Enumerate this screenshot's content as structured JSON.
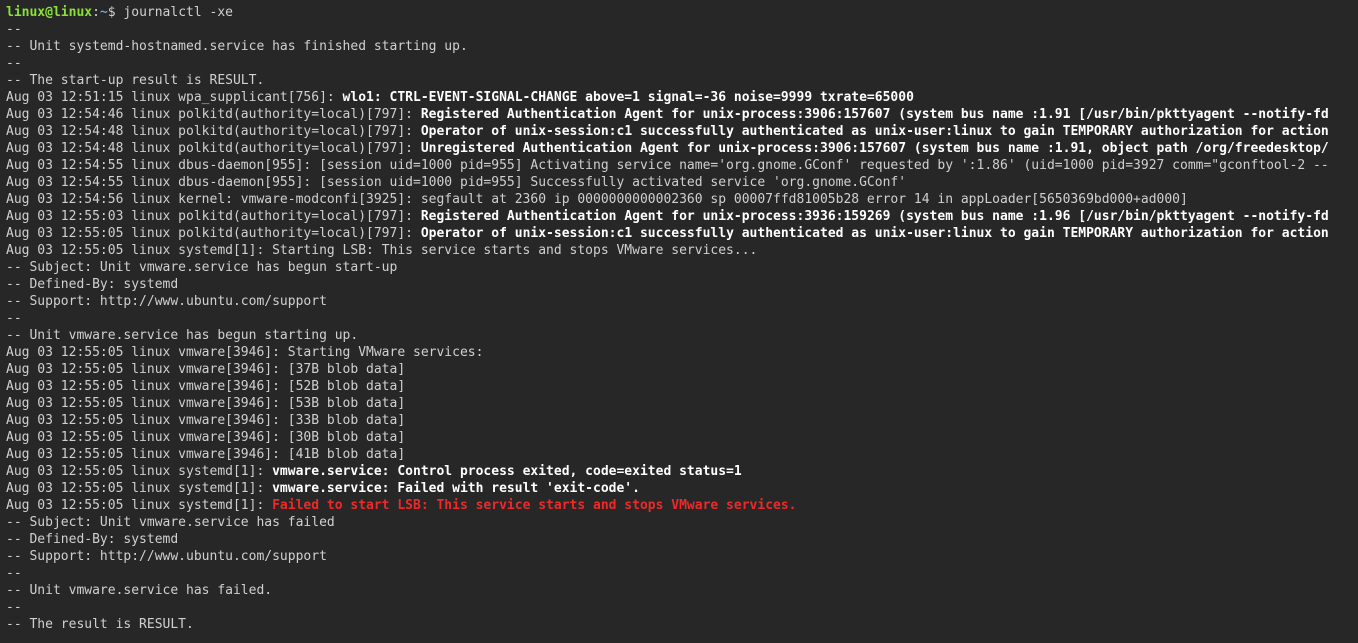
{
  "prompt": {
    "user": "linux",
    "host": "linux",
    "path": "~",
    "command": "journalctl -xe"
  },
  "lines": [
    {
      "t": "--",
      "cls": ""
    },
    {
      "t": "-- Unit systemd-hostnamed.service has finished starting up.",
      "cls": ""
    },
    {
      "t": "--",
      "cls": ""
    },
    {
      "t": "-- The start-up result is RESULT.",
      "cls": ""
    },
    {
      "pre": "Aug 03 12:51:15 linux wpa_supplicant[756]: ",
      "bold": "wlo1: CTRL-EVENT-SIGNAL-CHANGE above=1 signal=-36 noise=9999 txrate=65000"
    },
    {
      "pre": "Aug 03 12:54:46 linux polkitd(authority=local)[797]: ",
      "bold": "Registered Authentication Agent for unix-process:3906:157607 (system bus name :1.91 [/usr/bin/pkttyagent --notify-fd"
    },
    {
      "pre": "Aug 03 12:54:48 linux polkitd(authority=local)[797]: ",
      "bold": "Operator of unix-session:c1 successfully authenticated as unix-user:linux to gain TEMPORARY authorization for action"
    },
    {
      "pre": "Aug 03 12:54:48 linux polkitd(authority=local)[797]: ",
      "bold": "Unregistered Authentication Agent for unix-process:3906:157607 (system bus name :1.91, object path /org/freedesktop/"
    },
    {
      "t": "Aug 03 12:54:55 linux dbus-daemon[955]: [session uid=1000 pid=955] Activating service name='org.gnome.GConf' requested by ':1.86' (uid=1000 pid=3927 comm=\"gconftool-2 --",
      "cls": ""
    },
    {
      "t": "Aug 03 12:54:55 linux dbus-daemon[955]: [session uid=1000 pid=955] Successfully activated service 'org.gnome.GConf'",
      "cls": ""
    },
    {
      "t": "Aug 03 12:54:56 linux kernel: vmware-modconfi[3925]: segfault at 2360 ip 0000000000002360 sp 00007ffd81005b28 error 14 in appLoader[5650369bd000+ad000]",
      "cls": ""
    },
    {
      "pre": "Aug 03 12:55:03 linux polkitd(authority=local)[797]: ",
      "bold": "Registered Authentication Agent for unix-process:3936:159269 (system bus name :1.96 [/usr/bin/pkttyagent --notify-fd"
    },
    {
      "pre": "Aug 03 12:55:05 linux polkitd(authority=local)[797]: ",
      "bold": "Operator of unix-session:c1 successfully authenticated as unix-user:linux to gain TEMPORARY authorization for action"
    },
    {
      "t": "Aug 03 12:55:05 linux systemd[1]: Starting LSB: This service starts and stops VMware services...",
      "cls": ""
    },
    {
      "t": "-- Subject: Unit vmware.service has begun start-up",
      "cls": ""
    },
    {
      "t": "-- Defined-By: systemd",
      "cls": ""
    },
    {
      "t": "-- Support: http://www.ubuntu.com/support",
      "cls": ""
    },
    {
      "t": "--",
      "cls": ""
    },
    {
      "t": "-- Unit vmware.service has begun starting up.",
      "cls": ""
    },
    {
      "t": "Aug 03 12:55:05 linux vmware[3946]: Starting VMware services:",
      "cls": ""
    },
    {
      "t": "Aug 03 12:55:05 linux vmware[3946]: [37B blob data]",
      "cls": ""
    },
    {
      "t": "Aug 03 12:55:05 linux vmware[3946]: [52B blob data]",
      "cls": ""
    },
    {
      "t": "Aug 03 12:55:05 linux vmware[3946]: [53B blob data]",
      "cls": ""
    },
    {
      "t": "Aug 03 12:55:05 linux vmware[3946]: [33B blob data]",
      "cls": ""
    },
    {
      "t": "Aug 03 12:55:05 linux vmware[3946]: [30B blob data]",
      "cls": ""
    },
    {
      "t": "Aug 03 12:55:05 linux vmware[3946]: [41B blob data]",
      "cls": ""
    },
    {
      "pre": "Aug 03 12:55:05 linux systemd[1]: ",
      "bold": "vmware.service: Control process exited, code=exited status=1"
    },
    {
      "pre": "Aug 03 12:55:05 linux systemd[1]: ",
      "bold": "vmware.service: Failed with result 'exit-code'."
    },
    {
      "pre": "Aug 03 12:55:05 linux systemd[1]: ",
      "red": "Failed to start LSB: This service starts and stops VMware services."
    },
    {
      "t": "-- Subject: Unit vmware.service has failed",
      "cls": ""
    },
    {
      "t": "-- Defined-By: systemd",
      "cls": ""
    },
    {
      "t": "-- Support: http://www.ubuntu.com/support",
      "cls": ""
    },
    {
      "t": "--",
      "cls": ""
    },
    {
      "t": "-- Unit vmware.service has failed.",
      "cls": ""
    },
    {
      "t": "--",
      "cls": ""
    },
    {
      "t": "-- The result is RESULT.",
      "cls": ""
    }
  ]
}
